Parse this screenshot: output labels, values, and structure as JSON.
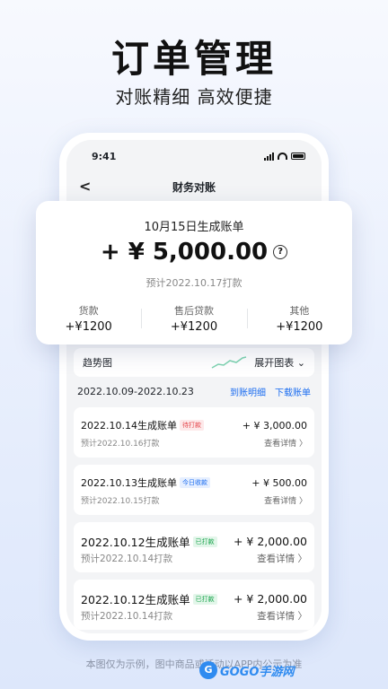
{
  "hero": {
    "title": "订单管理",
    "subtitle": "对账精细 高效便捷"
  },
  "status_bar": {
    "time": "9:41"
  },
  "nav": {
    "title": "财务对账",
    "back_glyph": "<"
  },
  "summary": {
    "date_label": "10月15日生成账单",
    "amount": "+ ¥ 5,000.00",
    "help_glyph": "?",
    "expected": "预计2022.10.17打款",
    "stats": [
      {
        "label": "货款",
        "value": "+¥1200"
      },
      {
        "label": "售后贷款",
        "value": "+¥1200"
      },
      {
        "label": "其他",
        "value": "+¥1200"
      }
    ]
  },
  "trend": {
    "label": "趋势图",
    "expand_label": "展开图表",
    "line_color": "#7dd3b0"
  },
  "period": {
    "range": "2022.10.09-2022.10.23",
    "link_detail": "到账明细",
    "link_download": "下载账单"
  },
  "bills": [
    {
      "name": "2022.10.14生成账单",
      "badge": "待打款",
      "amount": "+ ¥ 3,000.00",
      "expected": "预计2022.10.16打款",
      "detail": "查看详情 〉"
    },
    {
      "name": "2022.10.13生成账单",
      "badge": "今日收款",
      "amount": "+ ¥ 500.00",
      "expected": "预计2022.10.15打款",
      "detail": "查看详情 〉"
    },
    {
      "name": "2022.10.12生成账单",
      "badge": "已打款",
      "amount": "+ ¥ 2,000.00",
      "expected": "预计2022.10.14打款",
      "detail": "查看详情 〉"
    },
    {
      "name": "2022.10.12生成账单",
      "badge": "已打款",
      "amount": "+ ¥ 2,000.00",
      "expected": "预计2022.10.14打款",
      "detail": "查看详情 〉"
    }
  ],
  "footer": {
    "note": "本图仅为示例，图中商品或活动以APP内公示为准"
  },
  "watermark": {
    "logo": "G",
    "text": "GOGO手游网"
  },
  "colors": {
    "accent": "#1a6cf0",
    "pending": "#e5484d",
    "paid": "#16a34a"
  }
}
